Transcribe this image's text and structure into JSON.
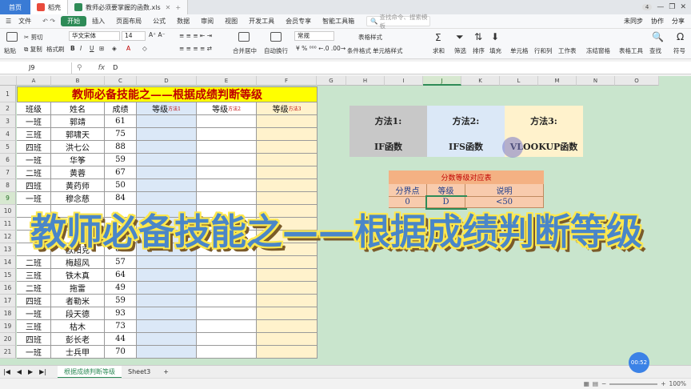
{
  "window": {
    "home_tab": "首页",
    "app_tab": "稻壳",
    "file_tab": "教师必须要掌握的函数.xls",
    "tab_count_badge": "4"
  },
  "menu": {
    "items": [
      "文件",
      "开始",
      "插入",
      "页面布局",
      "公式",
      "数据",
      "审阅",
      "视图",
      "开发工具",
      "会员专享",
      "智能工具箱"
    ],
    "search_placeholder": "查找命令、搜索模板",
    "right": [
      "未同步",
      "协作",
      "分享"
    ]
  },
  "ribbon": {
    "paste": "粘贴",
    "cut": "剪切",
    "copy": "复制",
    "format_painter": "格式刷",
    "font_name": "华文宋体",
    "font_size": "14",
    "merge": "合并居中",
    "wrap": "自动换行",
    "number_format": "常规",
    "table_style": "表格样式",
    "cond_format": "条件格式",
    "cell_style": "单元格样式",
    "sum": "求和",
    "filter": "筛选",
    "sort": "排序",
    "fill": "填充",
    "cell": "单元格",
    "rowcol": "行和列",
    "sheet": "工作表",
    "freeze": "冻结窗格",
    "table_tools": "表格工具",
    "find": "查找",
    "symbol": "符号"
  },
  "formula_bar": {
    "name_box": "J9",
    "fx": "fx",
    "value": "D"
  },
  "columns": [
    "A",
    "B",
    "C",
    "D",
    "E",
    "F",
    "G",
    "H",
    "I",
    "J",
    "K",
    "L",
    "M",
    "N",
    "O"
  ],
  "rows": [
    "1",
    "2",
    "3",
    "4",
    "5",
    "6",
    "7",
    "8",
    "9",
    "10",
    "11",
    "12",
    "13",
    "14",
    "15",
    "16",
    "17",
    "18",
    "19",
    "20",
    "21"
  ],
  "sheet_title": "教师必备技能之——根据成绩判断等级",
  "table_header": {
    "class": "班级",
    "name": "姓名",
    "score": "成绩",
    "grade": "等级",
    "m1": "方法1",
    "m2": "方法2",
    "m3": "方法3"
  },
  "table_rows": [
    {
      "class": "一班",
      "name": "郭靖",
      "score": "61"
    },
    {
      "class": "三班",
      "name": "郭啸天",
      "score": "75"
    },
    {
      "class": "四班",
      "name": "洪七公",
      "score": "88"
    },
    {
      "class": "一班",
      "name": "华筝",
      "score": "59"
    },
    {
      "class": "二班",
      "name": "黄蓉",
      "score": "67"
    },
    {
      "class": "四班",
      "name": "黄药师",
      "score": "50"
    },
    {
      "class": "一班",
      "name": "穆念慈",
      "score": "84"
    },
    {
      "class": "",
      "name": "",
      "score": ""
    },
    {
      "class": "",
      "name": "",
      "score": ""
    },
    {
      "class": "",
      "name": "",
      "score": ""
    },
    {
      "class": "",
      "name": "欧阳克",
      "score": "88"
    },
    {
      "class": "二班",
      "name": "梅超风",
      "score": "57"
    },
    {
      "class": "三班",
      "name": "铁木真",
      "score": "64"
    },
    {
      "class": "二班",
      "name": "拖雷",
      "score": "49"
    },
    {
      "class": "四班",
      "name": "者勒米",
      "score": "59"
    },
    {
      "class": "一班",
      "name": "段天德",
      "score": "93"
    },
    {
      "class": "三班",
      "name": "枯木",
      "score": "73"
    },
    {
      "class": "四班",
      "name": "彭长老",
      "score": "44"
    },
    {
      "class": "一班",
      "name": "士兵甲",
      "score": "70"
    }
  ],
  "methods": [
    {
      "title": "方法1:",
      "func": "IF函数",
      "color": "#c8c8c8"
    },
    {
      "title": "方法2:",
      "func": "IFS函数",
      "color": "#dbe8f7"
    },
    {
      "title": "方法3:",
      "func": "VLOOKUP函数",
      "color": "#fff2cc"
    }
  ],
  "mapping": {
    "title": "分数等级对应表",
    "headers": [
      "分界点",
      "等级",
      "说明"
    ],
    "row": [
      "0",
      "D",
      "<50"
    ]
  },
  "overlay_title": "教师必备技能之——根据成绩判断等级",
  "sheets": {
    "active": "根据成绩判断等级",
    "other": "Sheet3",
    "add": "+"
  },
  "timer": "00:52",
  "zoom": "100%",
  "colors": {
    "sheet_bg": "#c9e5cd",
    "title_yellow": "#ffff00",
    "title_red": "#c00000",
    "mapping_orange": "#f8cbad",
    "accent_green": "#2e8b57"
  }
}
